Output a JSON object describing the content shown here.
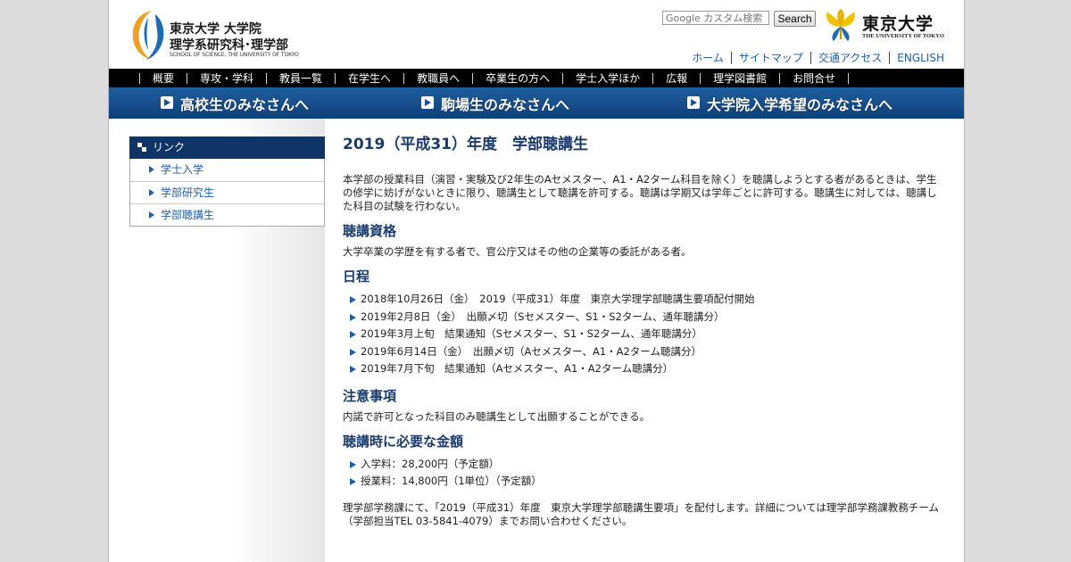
{
  "header": {
    "logo_line1": "東京大学 大学院",
    "logo_line2": "理学系研究科･理学部",
    "logo_line3": "SCHOOL OF SCIENCE, THE UNIVERSITY OF TOKYO",
    "search_placeholder": "Google カスタム検索",
    "search_button": "Search",
    "utokyo_jp": "東京大学",
    "utokyo_en": "THE UNIVERSITY OF TOKYO",
    "util_nav": [
      "ホーム",
      "サイトマップ",
      "交通アクセス",
      "ENGLISH"
    ]
  },
  "global_nav": [
    "概要",
    "専攻・学科",
    "教員一覧",
    "在学生へ",
    "教職員へ",
    "卒業生の方へ",
    "学士入学ほか",
    "広報",
    "理学図書館",
    "お問合せ"
  ],
  "banner": [
    "高校生のみなさんへ",
    "駒場生のみなさんへ",
    "大学院入学希望のみなさんへ"
  ],
  "sidebar": {
    "heading": "リンク",
    "items": [
      "学士入学",
      "学部研究生",
      "学部聴講生"
    ]
  },
  "main": {
    "title": "2019（平成31）年度　学部聴講生",
    "intro": "本学部の授業科目（演習・実験及び2年生のAセメスター、A1・A2ターム科目を除く）を聴講しようとする者があるときは、学生の修学に妨げがないときに限り、聴講生として聴講を許可する。聴講は学期又は学年ごとに許可する。聴講生に対しては、聴講した科目の試験を行わない。",
    "qualification_heading": "聴講資格",
    "qualification_text": "大学卒業の学歴を有する者で、官公庁又はその他の企業等の委託がある者。",
    "schedule_heading": "日程",
    "schedule": [
      "2018年10月26日（金）　2019（平成31）年度　東京大学理学部聴講生要項配付開始",
      "2019年2月8日（金）　出願〆切（Sセメスター、S1・S2ターム、通年聴講分）",
      "2019年3月上旬　結果通知（Sセメスター、S1・S2ターム、通年聴講分）",
      "2019年6月14日（金）　出願〆切（Aセメスター、A1・A2ターム聴講分）",
      "2019年7月下旬　結果通知（Aセメスター、A1・A2ターム聴講分）"
    ],
    "notes_heading": "注意事項",
    "notes_text": "内諾で許可となった科目のみ聴講生として出願することができる。",
    "fees_heading": "聴講時に必要な金額",
    "fees": [
      "入学料：28,200円（予定額）",
      "授業料：14,800円（1単位）（予定額）"
    ],
    "footer_text": "理学部学務課にて、「2019（平成31）年度　東京大学理学部聴講生要項」を配付します。詳細については理学部学務課教務チーム（学部担当TEL 03-5841-4079）までお問い合わせください。"
  },
  "colors": {
    "nav_bg": "#000000",
    "banner_bg": "#1b4f8e",
    "heading": "#1a3a6a",
    "link": "#1f5fa8",
    "sidebar_head": "#0e3565",
    "logo_orange": "#f0a020",
    "logo_blue": "#1f6cb4",
    "ginkgo": "#f2c200"
  }
}
